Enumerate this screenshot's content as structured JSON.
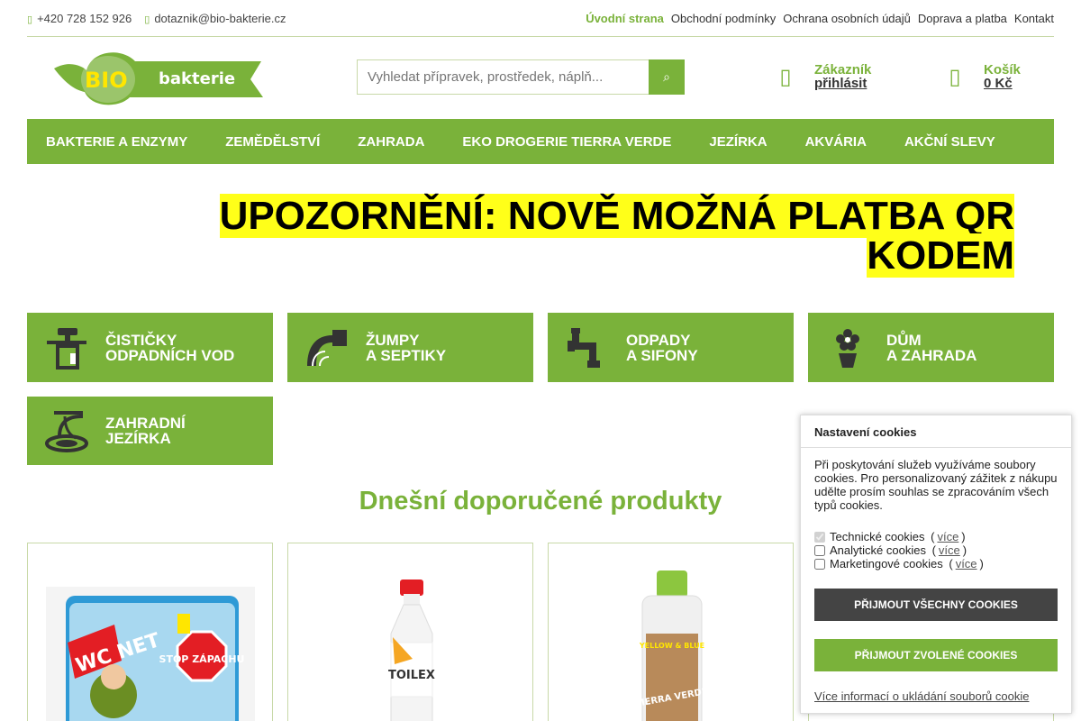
{
  "topbar": {
    "phone": "+420 728 152 926",
    "email": "dotaznik@bio-bakterie.cz",
    "links": [
      "Úvodní strana",
      "Obchodní podmínky",
      "Ochrana osobních údajů",
      "Doprava a platba",
      "Kontakt"
    ]
  },
  "logo": {
    "text_bio": "BIO",
    "text_bakterie": "bakterie"
  },
  "search": {
    "placeholder": "Vyhledat přípravek, prostředek, náplň..."
  },
  "account": {
    "label": "Zákazník",
    "action": "přihlásit"
  },
  "cart": {
    "label": "Košík",
    "total": "0 Kč"
  },
  "nav": [
    "BAKTERIE A ENZYMY",
    "ZEMĚDĚLSTVÍ",
    "ZAHRADA",
    "EKO DROGERIE TIERRA VERDE",
    "JEZÍRKA",
    "AKVÁRIA",
    "AKČNÍ SLEVY"
  ],
  "notice": {
    "line1": "UPOZORNĚNÍ: NOVĚ MOŽNÁ PLATBA QR",
    "line2": "KODEM"
  },
  "categories": [
    {
      "l1": "ČISTIČKY",
      "l2": "ODPADNÍCH VOD"
    },
    {
      "l1": "ŽUMPY",
      "l2": "A SEPTIKY"
    },
    {
      "l1": "ODPADY",
      "l2": "A SIFONY"
    },
    {
      "l1": "DŮM",
      "l2": "A ZAHRADA"
    },
    {
      "l1": "ZAHRADNÍ",
      "l2": "JEZÍRKA"
    }
  ],
  "products_title": "Dnešní doporučené produkty",
  "products": [
    {
      "brand": "WC NET",
      "badge": "STOP ZÁPACHU"
    },
    {
      "brand": "TOILEX"
    },
    {
      "brand": "YELLOW & BLUE",
      "sub": "TIERRA VERDE"
    }
  ],
  "cookies": {
    "title": "Nastavení cookies",
    "text": "Při poskytování služeb využíváme soubory cookies. Pro personalizovaný zážitek z nákupu udělte prosím souhlas se zpracováním všech typů cookies.",
    "options": [
      {
        "label": "Technické cookies",
        "more": "více",
        "checked": true,
        "disabled": true
      },
      {
        "label": "Analytické cookies",
        "more": "více",
        "checked": false
      },
      {
        "label": "Marketingové cookies",
        "more": "více",
        "checked": false
      }
    ],
    "accept_all": "PŘIJMOUT VŠECHNY COOKIES",
    "accept_selected": "PŘIJMOUT ZVOLENÉ COOKIES",
    "more_info": "Více informací o ukládání souborů cookie"
  },
  "colors": {
    "brand_green": "#7ab23a",
    "notice_yellow": "#ffff19",
    "dark_button": "#444444"
  }
}
